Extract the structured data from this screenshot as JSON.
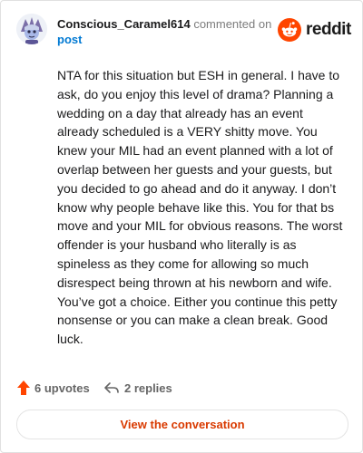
{
  "comment": {
    "author": "Conscious_Caramel614",
    "meta_text": "commented on",
    "post_link": "post",
    "body": "NTA for this situation but ESH in general. I have to ask, do you enjoy this level of drama? Planning a wedding on a day that already has an event already scheduled is a VERY shitty move. You knew your MIL had an event planned with a lot of overlap between her guests and your guests, but you decided to go ahead and do it anyway. I don’t know why people behave like this. You for that bs move and your MIL for obvious reasons. The worst offender is your husband who literally is as spineless as they come for allowing so much disrespect being thrown at his newborn and wife. You’ve got a choice. Either you continue this petty nonsense or you can make a clean break. Good luck."
  },
  "brand": {
    "name": "reddit",
    "color": "#ff4500",
    "icons": [
      "snoo-logo-icon"
    ]
  },
  "actions": {
    "upvotes": "6 upvotes",
    "replies": "2 replies",
    "upvote_color": "#ff4500",
    "icons": [
      "upvote-arrow-icon",
      "reply-arrow-icon"
    ]
  },
  "cta": {
    "label": "View the conversation",
    "color": "#d93a00"
  }
}
